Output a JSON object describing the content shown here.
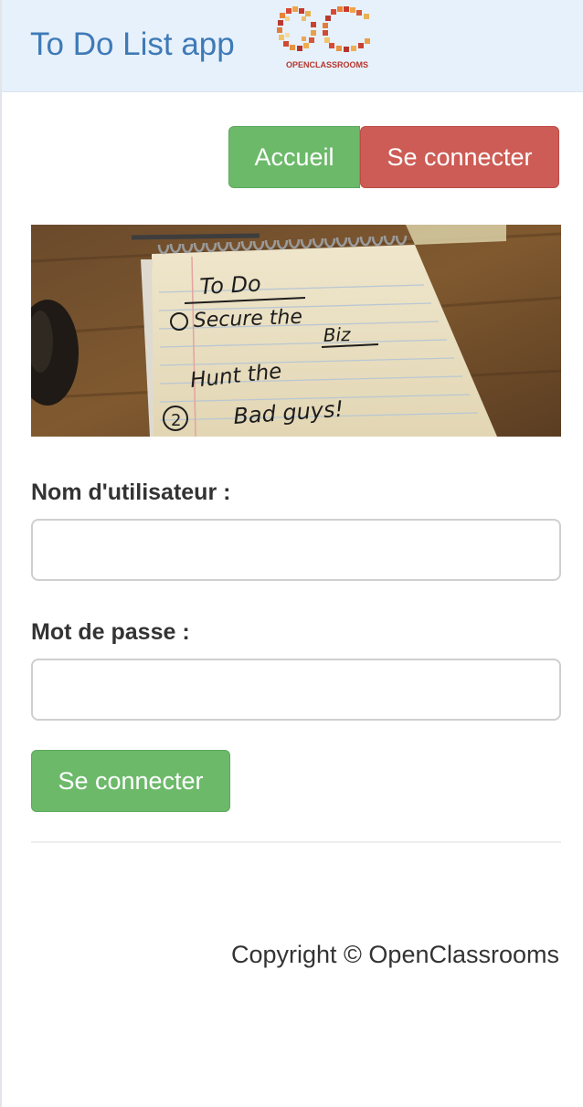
{
  "navbar": {
    "brand": "To Do List app",
    "logo_text": "OPENCLASSROOMS",
    "logo_letters": "OC"
  },
  "header_buttons": {
    "home_label": "Accueil",
    "login_label": "Se connecter"
  },
  "hero": {
    "note_lines": [
      "To Do",
      "Secure the",
      "Biz",
      "Hunt the",
      "Bad guys!"
    ]
  },
  "login_form": {
    "username_label": "Nom d'utilisateur :",
    "username_value": "",
    "password_label": "Mot de passe :",
    "password_value": "",
    "submit_label": "Se connecter"
  },
  "footer": {
    "copyright": "Copyright © OpenClassrooms"
  },
  "colors": {
    "navbar_bg": "#e7f1fb",
    "brand": "#3f7ab7",
    "success": "#6cb96a",
    "danger": "#cc5c55"
  }
}
